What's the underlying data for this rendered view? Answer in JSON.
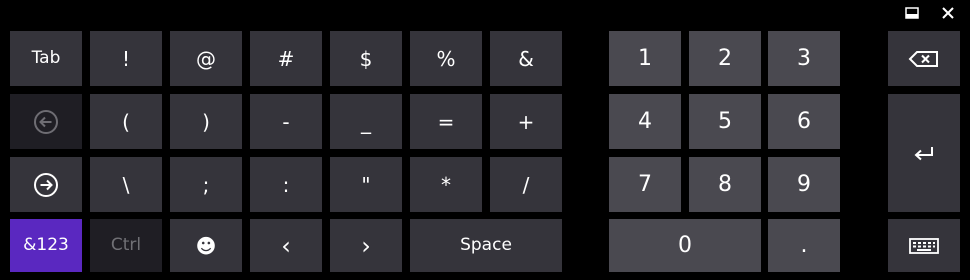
{
  "window_controls": {
    "dock_icon": "dock-icon",
    "close_icon": "close-icon"
  },
  "keys": {
    "tab": "Tab",
    "exclaim": "!",
    "at": "@",
    "hash": "#",
    "dollar": "$",
    "percent": "%",
    "ampersand": "&",
    "lparen": "(",
    "rparen": ")",
    "minus": "-",
    "underscore": "_",
    "equals": "=",
    "plus": "+",
    "backslash": "\\",
    "semicolon": ";",
    "colon": ":",
    "quote": "\"",
    "asterisk": "*",
    "slash": "/",
    "mode": "&123",
    "ctrl": "Ctrl",
    "emoji": "☻",
    "left": "‹",
    "right": "›",
    "space": "Space",
    "n1": "1",
    "n2": "2",
    "n3": "3",
    "n4": "4",
    "n5": "5",
    "n6": "6",
    "n7": "7",
    "n8": "8",
    "n9": "9",
    "n0": "0",
    "dot": "."
  },
  "icons": {
    "back": "circle-arrow-left-icon",
    "forward": "circle-arrow-right-icon",
    "backspace": "backspace-icon",
    "enter": "enter-icon",
    "keyboard": "keyboard-icon"
  },
  "colors": {
    "background": "#000000",
    "key": "#35343b",
    "key_dark": "#1f1e24",
    "num_key": "#4a4950",
    "accent": "#5a28c0"
  }
}
